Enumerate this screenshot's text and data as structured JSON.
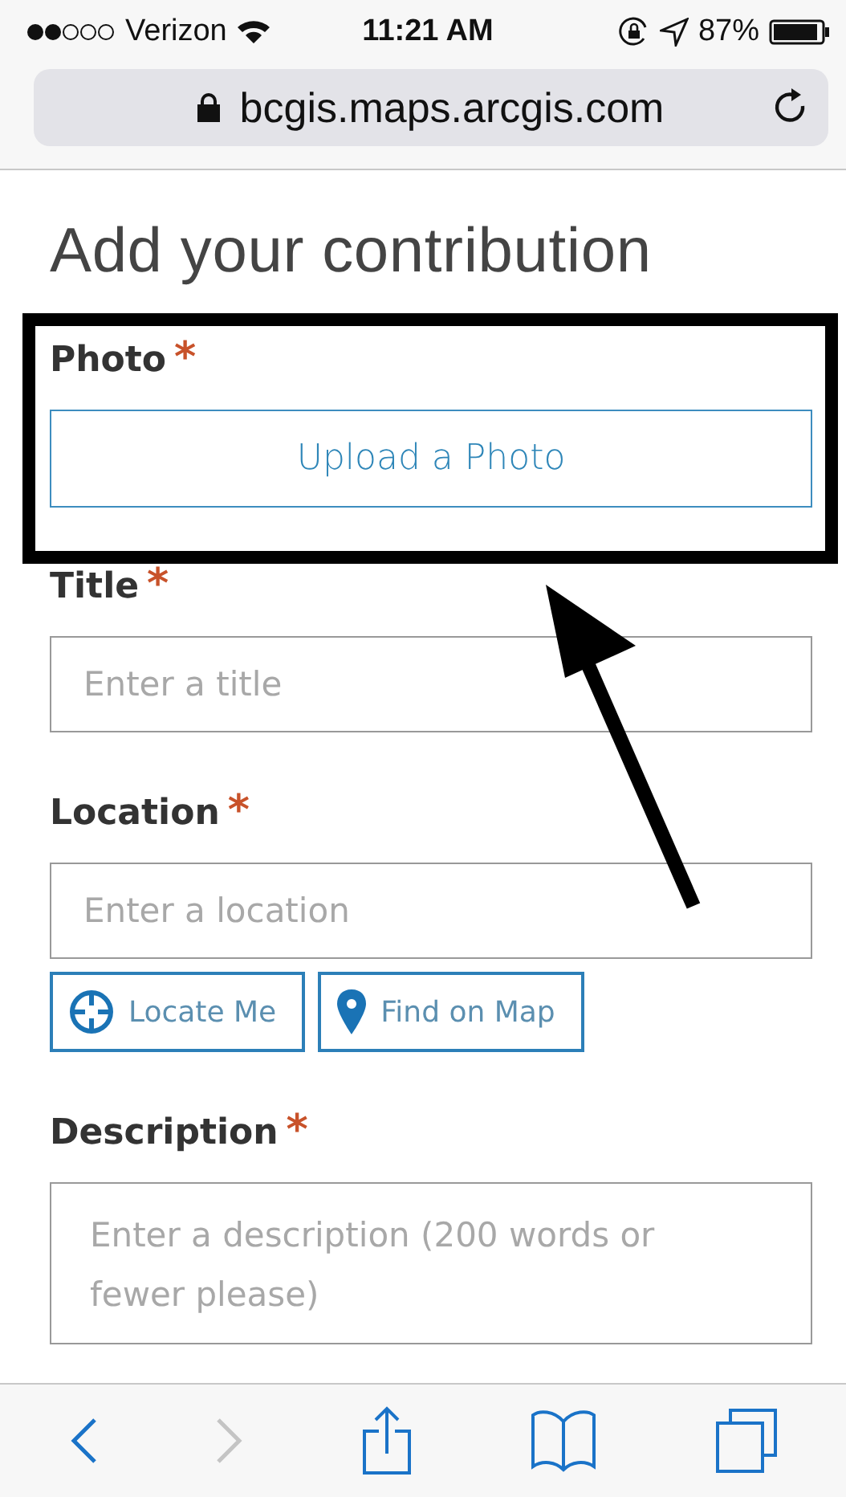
{
  "status_bar": {
    "carrier": "Verizon",
    "time": "11:21 AM",
    "battery": "87%"
  },
  "address_bar": {
    "url": "bcgis.maps.arcgis.com"
  },
  "heading": "Add your contribution",
  "fields": [
    {
      "kind": "photo",
      "label": "Photo",
      "marker": "*",
      "button": "Upload a Photo"
    },
    {
      "kind": "text",
      "label": "Title",
      "marker": "*",
      "placeholder": "Enter a title"
    },
    {
      "kind": "text",
      "label": "Location",
      "marker": "*",
      "placeholder": "Enter a location",
      "actions": [
        {
          "kind": "locate",
          "label": "Locate Me"
        },
        {
          "kind": "pin",
          "label": "Find on Map"
        }
      ]
    },
    {
      "kind": "textarea",
      "label": "Description",
      "marker": "*",
      "placeholder": "Enter a description (200 words or fewer please)"
    }
  ],
  "toolbar": [
    {
      "kind": "back",
      "disabled": false
    },
    {
      "kind": "forward",
      "disabled": true
    },
    {
      "kind": "share",
      "disabled": false
    },
    {
      "kind": "bookmarks",
      "disabled": false
    },
    {
      "kind": "tabs",
      "disabled": false
    }
  ]
}
